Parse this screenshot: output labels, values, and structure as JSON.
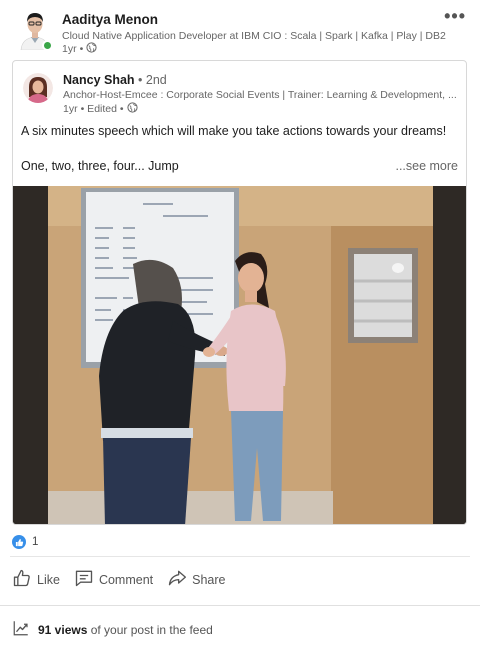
{
  "author": {
    "name": "Aaditya Menon",
    "headline": "Cloud Native Application Developer at IBM CIO : Scala | Spark | Kafka | Play | DB2",
    "time": "1yr",
    "separator": "•"
  },
  "more_label": "•••",
  "shared_post": {
    "author_name": "Nancy Shah",
    "degree": "• 2nd",
    "headline": "Anchor-Host-Emcee : Corporate Social Events | Trainer: Learning & Development, ...",
    "time": "1yr",
    "edited": "• Edited •",
    "text_line_1": "A six minutes speech which will make you take actions towards your dreams!",
    "text_line_2": "One, two, three, four... Jump",
    "see_more": "...see more"
  },
  "reactions": {
    "count": "1"
  },
  "actions": {
    "like": "Like",
    "comment": "Comment",
    "share": "Share"
  },
  "views": {
    "count": "91 views",
    "suffix": "of your post in the feed"
  },
  "colors": {
    "online": "#3aa648",
    "like_blue": "#378fe9"
  }
}
